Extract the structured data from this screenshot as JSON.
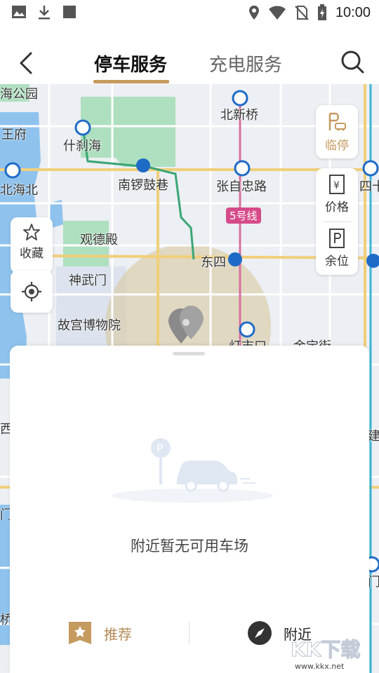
{
  "status_bar": {
    "time": "10:00",
    "left_icons": [
      "image-icon",
      "download-icon",
      "square-icon"
    ],
    "right_icons": [
      "location-icon",
      "wifi-icon",
      "no-sim-icon",
      "battery-charging-icon"
    ]
  },
  "header": {
    "tabs": [
      {
        "label": "停车服务",
        "active": true
      },
      {
        "label": "充电服务",
        "active": false
      }
    ],
    "accent_color": "#c59a5e"
  },
  "map": {
    "place_labels": [
      "海公园",
      "王府",
      "什刹海",
      "北新桥",
      "北海北",
      "南锣鼓巷",
      "张自忠路",
      "四十",
      "观德殿",
      "东四",
      "神武门",
      "故宫博物院",
      "灯市口",
      "金宝街",
      "西",
      "门",
      "建",
      "门",
      "桥"
    ],
    "metro_line_badge": "5号线",
    "side_buttons": {
      "temp_parking": "临停",
      "price": "价格",
      "vacancy": "余位",
      "favorite": "收藏"
    }
  },
  "sheet": {
    "empty_text": "附近暂无可用车场",
    "illustration_badge": "P",
    "footer_tabs": {
      "recommend": "推荐",
      "nearby": "附近"
    }
  },
  "watermark": {
    "text": "KK下载",
    "url": "www.kkx.net"
  }
}
